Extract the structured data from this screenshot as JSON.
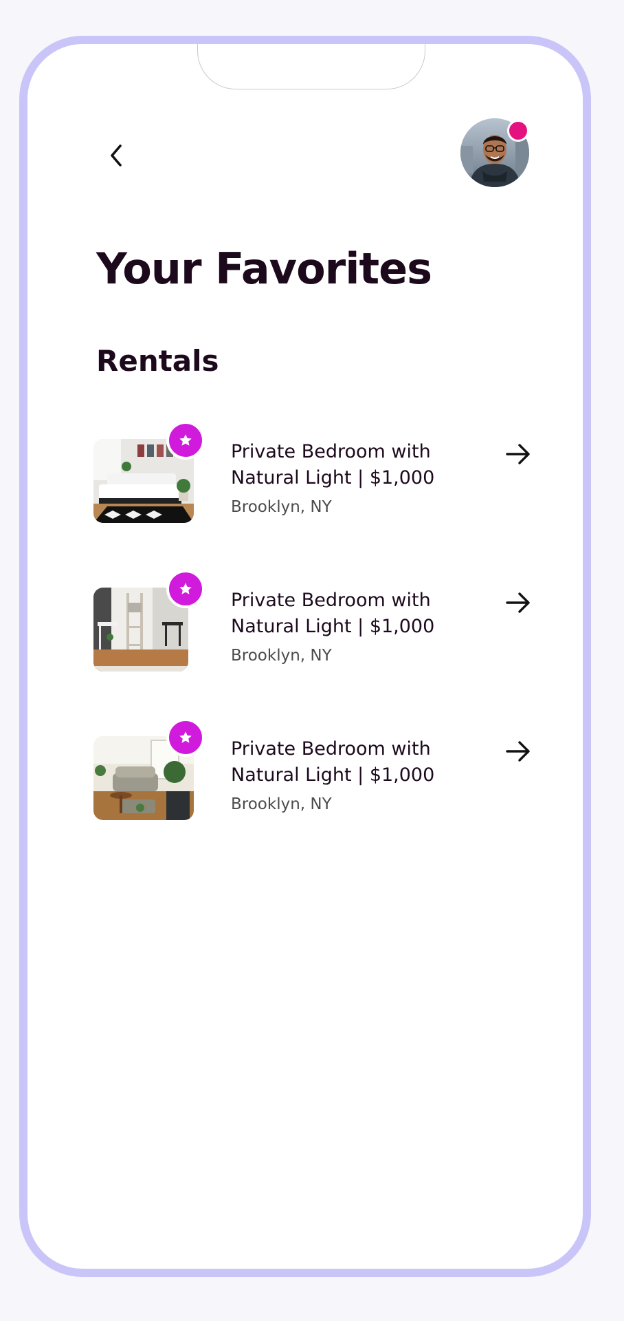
{
  "header": {
    "back_icon": "chevron-left-icon",
    "avatar_alt": "User profile photo",
    "notification_color": "#e3127f"
  },
  "page": {
    "title": "Your Favorites",
    "section_title": "Rentals"
  },
  "colors": {
    "frame": "#c9c5f8",
    "accent": "#d11bdc",
    "text": "#1c0a1c"
  },
  "rentals": [
    {
      "title": "Private Bedroom with Natural Light | $1,000",
      "location": "Brooklyn, NY",
      "image_label": "Bedroom with white bed and patterned rug",
      "favorite_icon": "star-icon",
      "action_icon": "arrow-right-icon"
    },
    {
      "title": "Private Bedroom with Natural Light | $1,000",
      "location": "Brooklyn, NY",
      "image_label": "Room with ladder shelf and wood floor",
      "favorite_icon": "star-icon",
      "action_icon": "arrow-right-icon"
    },
    {
      "title": "Private Bedroom with Natural Light | $1,000",
      "location": "Brooklyn, NY",
      "image_label": "Living room with sofa and plants",
      "favorite_icon": "star-icon",
      "action_icon": "arrow-right-icon"
    }
  ]
}
